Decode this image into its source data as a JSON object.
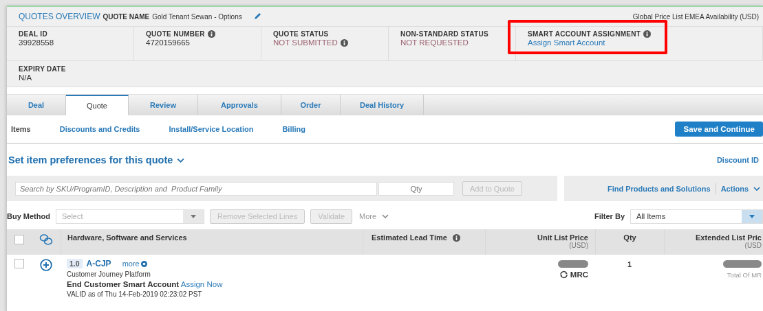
{
  "header": {
    "section": "QUOTES OVERVIEW",
    "name_label": "QUOTE NAME",
    "name": "Gold Tenant Sewan - Options",
    "price_list": "Global Price List EMEA Availability (USD)"
  },
  "summary": [
    {
      "label": "DEAL ID",
      "value": "39928558",
      "kind": "plain",
      "label_info": false,
      "value_info": false,
      "highlighted": false
    },
    {
      "label": "QUOTE NUMBER",
      "value": "4720159665",
      "kind": "plain",
      "label_info": true,
      "value_info": false,
      "highlighted": false
    },
    {
      "label": "QUOTE STATUS",
      "value": "NOT SUBMITTED",
      "kind": "status",
      "label_info": false,
      "value_info": true,
      "highlighted": false
    },
    {
      "label": "NON-STANDARD STATUS",
      "value": "NOT REQUESTED",
      "kind": "status",
      "label_info": false,
      "value_info": false,
      "highlighted": false
    },
    {
      "label": "SMART ACCOUNT ASSIGNMENT",
      "value": "Assign Smart Account",
      "kind": "link",
      "label_info": true,
      "value_info": false,
      "highlighted": true
    }
  ],
  "expiry": {
    "label": "EXPIRY DATE",
    "value": "N/A"
  },
  "tabs": [
    {
      "label": "Deal",
      "selected": false
    },
    {
      "label": "Quote",
      "selected": true
    },
    {
      "label": "Review",
      "selected": false
    },
    {
      "label": "Approvals",
      "selected": false
    },
    {
      "label": "Order",
      "selected": false
    },
    {
      "label": "Deal History",
      "selected": false
    }
  ],
  "subtabs": [
    {
      "label": "Items",
      "selected": true
    },
    {
      "label": "Discounts and Credits",
      "selected": false
    },
    {
      "label": "Install/Service Location",
      "selected": false
    },
    {
      "label": "Billing",
      "selected": false
    }
  ],
  "save_button": "Save and Continue",
  "preferences": "Set item preferences for this quote",
  "discount_id": "Discount ID",
  "search": {
    "placeholder": "Search by SKU/ProgramID, Description and  Product Family",
    "qty_placeholder": "Qty",
    "add_button": {
      "label": "Add to Quote",
      "disabled": true
    }
  },
  "find_link": "Find Products and Solutions",
  "actions": "Actions",
  "toolbar": {
    "buy_method_label": "Buy Method",
    "buy_method_placeholder": "Select",
    "buttons": [
      {
        "label": "Remove Selected Lines",
        "disabled": true
      },
      {
        "label": "Validate",
        "disabled": true
      }
    ],
    "more": "More",
    "filter_label": "Filter By",
    "filter_value": "All Items"
  },
  "table": {
    "all_checked": false,
    "columns": [
      {
        "label": "Hardware, Software and Services",
        "info": false
      },
      {
        "label": "Estimated Lead Time",
        "info": true
      },
      {
        "label": "Unit List Price",
        "sub": "(USD)",
        "info": false
      },
      {
        "label": "Qty",
        "info": false
      },
      {
        "label": "Extended List Pric",
        "sub": "(USD",
        "info": false
      }
    ],
    "rows": [
      {
        "checked": false,
        "line": "1.0",
        "sku": "A-CJP",
        "more": "more",
        "description": "Customer Journey Platform",
        "account_label": "End Customer Smart Account",
        "account_link": "Assign Now",
        "valid": "VALID as of Thu 14-Feb-2019 02:23:02 PST",
        "charge": "MRC",
        "qty": "1",
        "extended_note": "Total Of MR"
      }
    ]
  }
}
